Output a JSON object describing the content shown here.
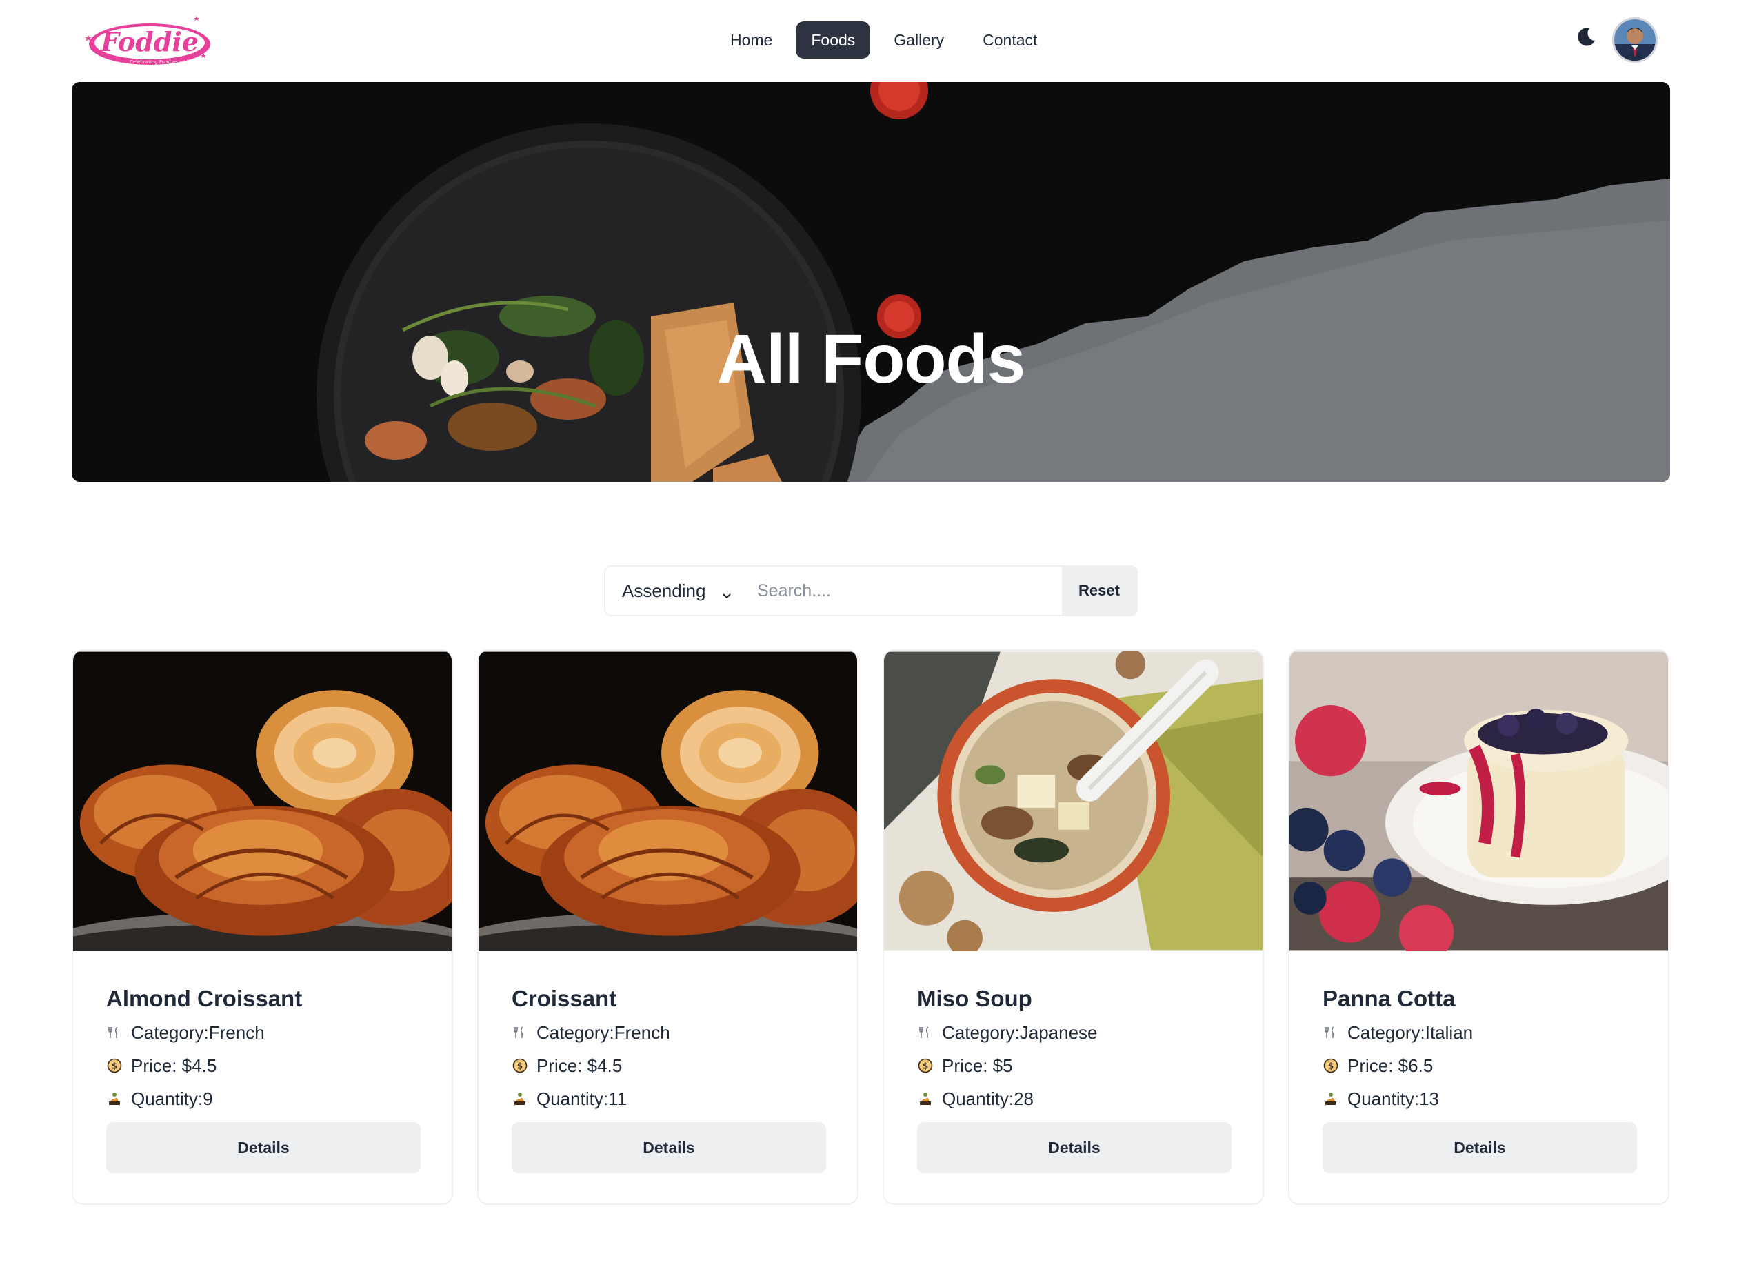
{
  "brand": {
    "logo_text": "Foddie",
    "logo_tagline": "Celebrating Food as a Lifestyle",
    "color": "#e6409b"
  },
  "nav": {
    "items": [
      {
        "label": "Home",
        "active": false
      },
      {
        "label": "Foods",
        "active": true
      },
      {
        "label": "Gallery",
        "active": false
      },
      {
        "label": "Contact",
        "active": false
      }
    ],
    "theme_icon": "moon-icon",
    "avatar_icon": "user-avatar"
  },
  "hero": {
    "title": "All Foods"
  },
  "filter": {
    "sort_value": "Assending",
    "search_placeholder": "Search....",
    "search_value": "",
    "reset_label": "Reset"
  },
  "labels": {
    "category": "Category: ",
    "price": "Price: $",
    "quantity": "Quantity: ",
    "details": "Details"
  },
  "foods": [
    {
      "name": "Almond Croissant",
      "category": "French",
      "price": "4.5",
      "quantity": "9",
      "image": "croissant"
    },
    {
      "name": "Croissant",
      "category": "French",
      "price": "4.5",
      "quantity": "11",
      "image": "croissant"
    },
    {
      "name": "Miso Soup",
      "category": "Japanese",
      "price": "5",
      "quantity": "28",
      "image": "miso-soup"
    },
    {
      "name": "Panna Cotta",
      "category": "Italian",
      "price": "6.5",
      "quantity": "13",
      "image": "panna-cotta"
    }
  ],
  "colors": {
    "active_nav_bg": "#2d3340",
    "button_bg": "#eeeff1",
    "text": "#1f2937"
  }
}
